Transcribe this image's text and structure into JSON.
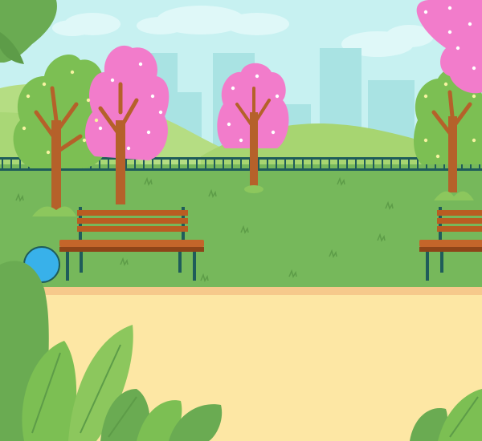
{
  "scene": {
    "kind": "park-game-background",
    "palette": {
      "sky": "#c7f1f1",
      "cloud": "#dff8f8",
      "building": "#a9e3e3",
      "hill_far": "#b5dd83",
      "hill_near": "#9fd06b",
      "grass": "#76b85b",
      "fence": "#1f5c5a",
      "path": "#fde7a4",
      "path_edge": "#f6c98b",
      "trunk": "#b5612a",
      "tree_green": "#7cbf53",
      "blossom_pink": "#f27ccb",
      "bench_wood": "#b95d22",
      "bench_leg": "#1f5c5a",
      "ball": "#38b1ea",
      "bush": "#6aab52"
    },
    "objects": {
      "ball": {
        "color": "#38b1ea",
        "shape": "circle"
      },
      "benches": [
        {
          "id": "left"
        },
        {
          "id": "right"
        }
      ],
      "trees": [
        {
          "type": "green-blossom"
        },
        {
          "type": "pink-blossom"
        },
        {
          "type": "pink-blossom"
        },
        {
          "type": "green-blossom"
        },
        {
          "type": "pink-blossom"
        }
      ]
    }
  }
}
